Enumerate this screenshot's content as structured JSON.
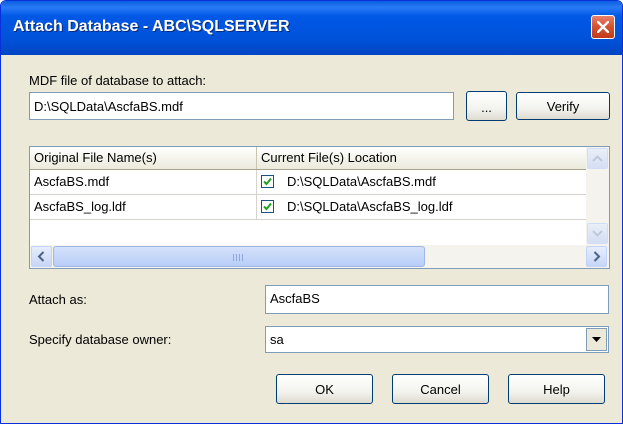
{
  "window": {
    "title": "Attach Database - ABC\\SQLSERVER"
  },
  "mdf": {
    "label": "MDF file of database to attach:",
    "value": "D:\\SQLData\\AscfaBS.mdf",
    "browse_label": "...",
    "verify_label": "Verify"
  },
  "grid": {
    "columns": [
      "Original File Name(s)",
      "Current File(s) Location"
    ],
    "rows": [
      {
        "original": "AscfaBS.mdf",
        "location": "D:\\SQLData\\AscfaBS.mdf",
        "checked": true
      },
      {
        "original": "AscfaBS_log.ldf",
        "location": "D:\\SQLData\\AscfaBS_log.ldf",
        "checked": true
      }
    ]
  },
  "attach_as": {
    "label": "Attach as:",
    "value": "AscfaBS"
  },
  "owner": {
    "label": "Specify database owner:",
    "value": "sa"
  },
  "buttons": {
    "ok": "OK",
    "cancel": "Cancel",
    "help": "Help"
  },
  "colors": {
    "titlebar": "#0052d9",
    "dialog_bg": "#ece9d8",
    "close_red": "#d5502f",
    "check_green": "#21a121"
  }
}
